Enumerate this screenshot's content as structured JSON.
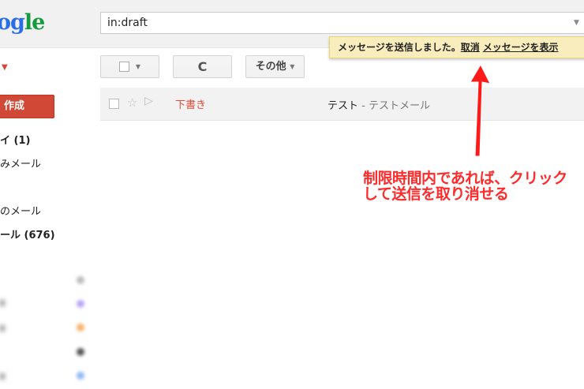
{
  "logo": {
    "part1": "o",
    "part2": "g",
    "part3": "le"
  },
  "search": {
    "value": "in:draft"
  },
  "notification": {
    "message": "メッセージを送信しました。",
    "undo_link": "取消",
    "view_link": "メッセージを表示"
  },
  "sidebar": {
    "compose_label": "作成",
    "items": [
      {
        "label": "イ (1)",
        "bold": true
      },
      {
        "label": "みメール",
        "bold": false
      },
      {
        "label": "のメール",
        "bold": false
      },
      {
        "label": "ール (676)",
        "bold": true
      }
    ]
  },
  "toolbar": {
    "refresh_icon": "C",
    "more_label": "その他"
  },
  "message_list": [
    {
      "label": "下書き",
      "subject": "テスト",
      "snippet": " - テストメール"
    }
  ],
  "annotation": {
    "line1": "制限時間内であれば、クリック",
    "line2": "して送信を取り消せる"
  },
  "colors": {
    "compose": "#d14836",
    "notification_bg": "#f9edbe",
    "annotation": "#ff2a2a"
  }
}
